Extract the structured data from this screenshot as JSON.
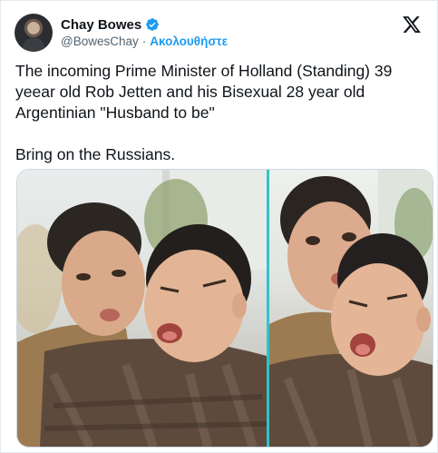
{
  "author": {
    "display_name": "Chay Bowes",
    "handle": "@BowesChay",
    "separator": "·",
    "follow_label": "Ακολουθήστε"
  },
  "post": {
    "paragraphs": [
      "The incoming Prime Minister of Holland (Standing) 39 yeear old Rob Jetten and his Bisexual 28 year old Argentinian \"Husband to be\"",
      "Bring on the Russians."
    ]
  },
  "icons": {
    "verified": "verified-badge-icon",
    "platform": "x-logo-icon"
  },
  "colors": {
    "accent": "#1d9bf0",
    "text": "#0f1419",
    "secondary": "#536471",
    "divider": "#2ec4c8"
  }
}
